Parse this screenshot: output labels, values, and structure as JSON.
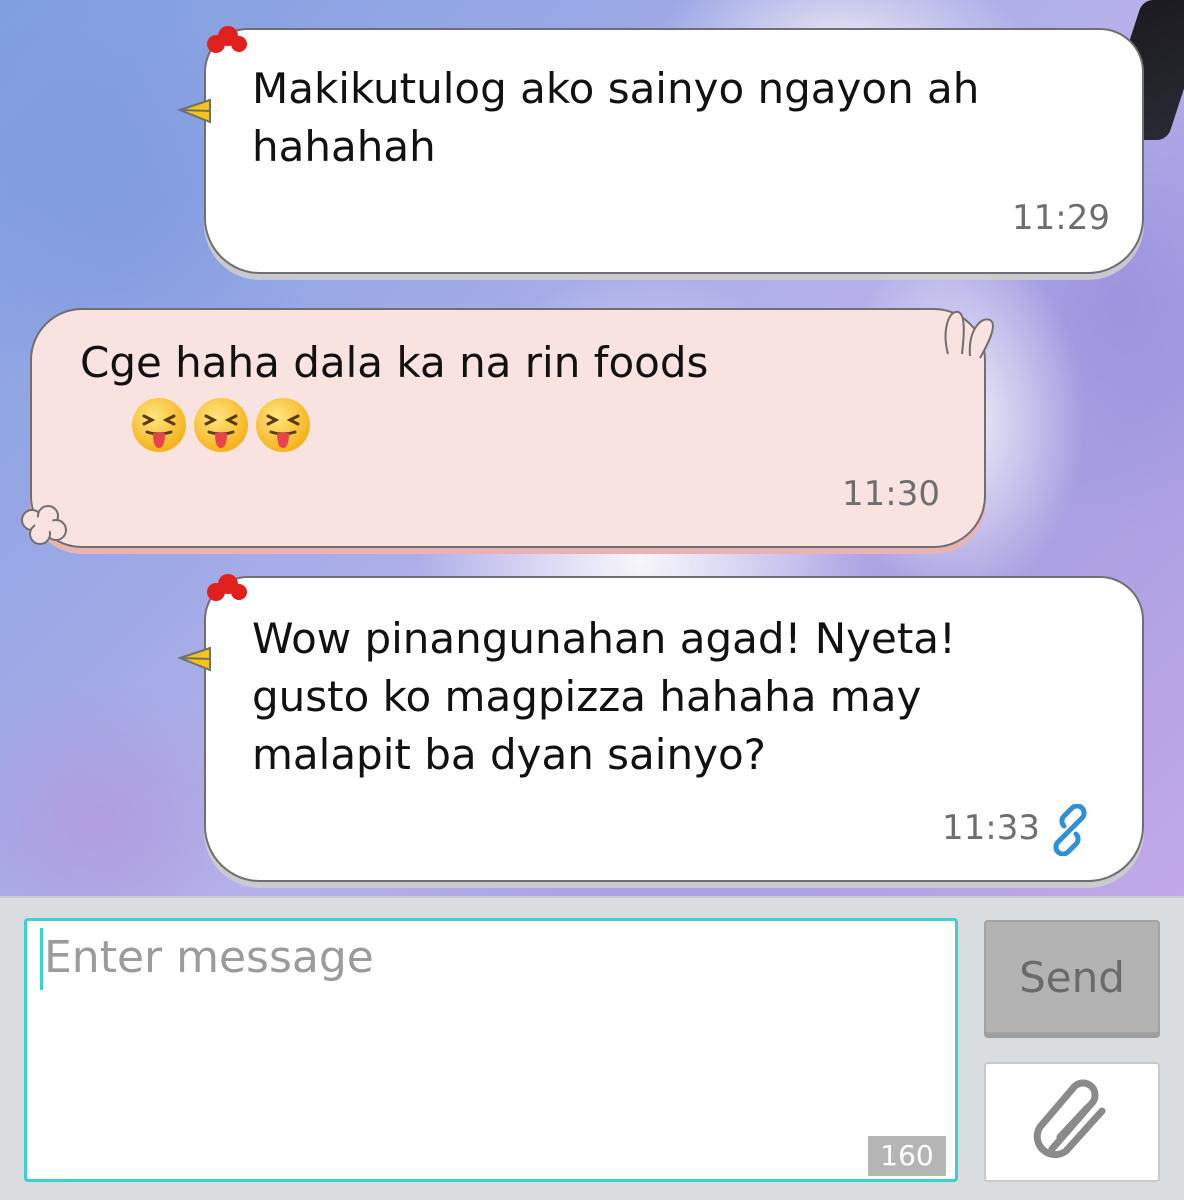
{
  "conversation": {
    "messages": [
      {
        "direction": "outgoing",
        "text": "Makikutulog ako sainyo ngayon ah\nhahahah",
        "time": "11:29"
      },
      {
        "direction": "incoming",
        "text": "Cge haha dala ka na rin foods",
        "emojis": [
          "squinting-tongue-face",
          "squinting-tongue-face",
          "squinting-tongue-face"
        ],
        "time": "11:30"
      },
      {
        "direction": "outgoing",
        "text": "Wow pinangunahan agad! Nyeta!\ngusto ko magpizza hahaha may\nmalapit ba dyan sainyo?",
        "time": "11:33",
        "status_icon": "link-icon"
      }
    ]
  },
  "composer": {
    "placeholder": "Enter message",
    "char_remaining": "160",
    "send_label": "Send",
    "attach_icon": "paperclip-icon"
  },
  "colors": {
    "accent": "#3ecfd0",
    "outgoing_bubble": "#ffffff",
    "incoming_bubble": "#f9e3e1",
    "send_button": "#b3b3b3",
    "link_icon": "#2f8fd8"
  }
}
